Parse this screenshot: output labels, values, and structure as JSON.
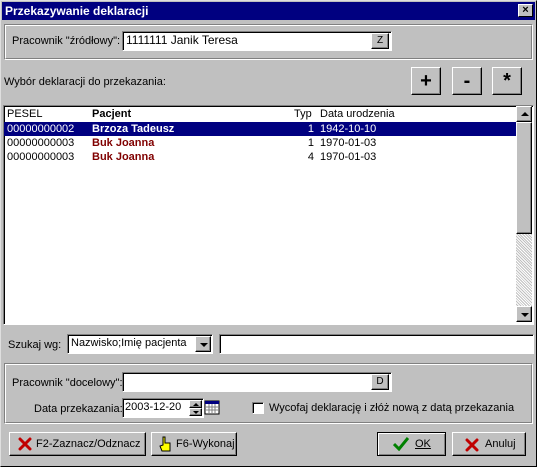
{
  "window": {
    "title": "Przekazywanie deklaracji",
    "close_glyph": "×"
  },
  "source_employee": {
    "label": "Pracownik \"źródłowy\":",
    "value": "1111111  Janik Teresa",
    "button_label": "Z"
  },
  "selection": {
    "label": "Wybór deklaracji do przekazania:",
    "add_label": "+",
    "remove_label": "-",
    "all_label": "*"
  },
  "table": {
    "columns": [
      "PESEL",
      "Pacjent",
      "Typ",
      "Data urodzenia"
    ],
    "rows": [
      {
        "pesel": "00000000002",
        "patient": "Brzoza Tadeusz",
        "type": "1",
        "birth_date": "1942-10-10",
        "selected": true
      },
      {
        "pesel": "00000000003",
        "patient": "Buk Joanna",
        "type": "1",
        "birth_date": "1970-01-03",
        "selected": false
      },
      {
        "pesel": "00000000003",
        "patient": "Buk Joanna",
        "type": "4",
        "birth_date": "1970-01-03",
        "selected": false
      }
    ]
  },
  "search": {
    "label": "Szukaj wg:",
    "criterion": "Nazwisko;Imię pacjenta",
    "value": ""
  },
  "target_employee": {
    "label": "Pracownik \"docelowy\":",
    "value": "",
    "button_label": "D"
  },
  "transfer_date": {
    "label": "Data przekazania:",
    "value": "2003-12-20"
  },
  "withdraw_option": {
    "label": "Wycofaj deklarację i złóż nową z datą przekazania",
    "checked": false
  },
  "footer": {
    "toggle_label": "F2-Zaznacz/Odznacz",
    "execute_label": "F6-Wykonaj",
    "ok_label": "OK",
    "cancel_label": "Anuluj"
  },
  "colors": {
    "title_bg": "#000080",
    "selection_bg": "#000080",
    "patient_text": "#800000",
    "face": "#c0c0c0"
  }
}
